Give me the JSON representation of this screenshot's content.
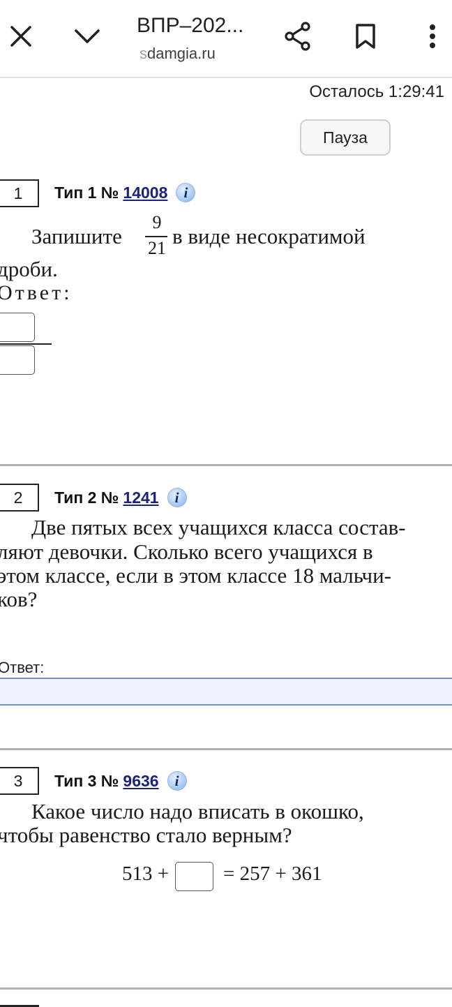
{
  "browser": {
    "title": "ВПР–202...",
    "url_prefix": "s",
    "url_rest": "damgia.ru"
  },
  "timer": {
    "text": "Осталось 1:29:41"
  },
  "pause_button": {
    "label": "Пауза"
  },
  "questions": [
    {
      "number": "1",
      "type_label": "Тип 1 №",
      "id": "14008",
      "text_before": "Запишите",
      "numerator": "9",
      "denominator": "21",
      "text_after": "в виде несократимой",
      "text_line2": "дроби.",
      "answer_label": "Ответ:"
    },
    {
      "number": "2",
      "type_label": "Тип 2 №",
      "id": "1241",
      "lines": [
        "Две пятых всех учащихся класса состав-",
        "ляют девочки. Сколько всего учащихся в",
        "этом классе, если в этом классе 18 мальчи-",
        "ков?"
      ],
      "answer_label": "Ответ:"
    },
    {
      "number": "3",
      "type_label": "Тип 3 №",
      "id": "9636",
      "lines": [
        "Какое число надо вписать в окошко,",
        "чтобы равенство стало верным?"
      ],
      "equation_left": "513 +",
      "equation_right": "=  257 + 361"
    }
  ],
  "icons": [
    "close-icon",
    "chevron-down-icon",
    "share-icon",
    "bookmark-icon",
    "more-vert-icon",
    "info-icon"
  ]
}
